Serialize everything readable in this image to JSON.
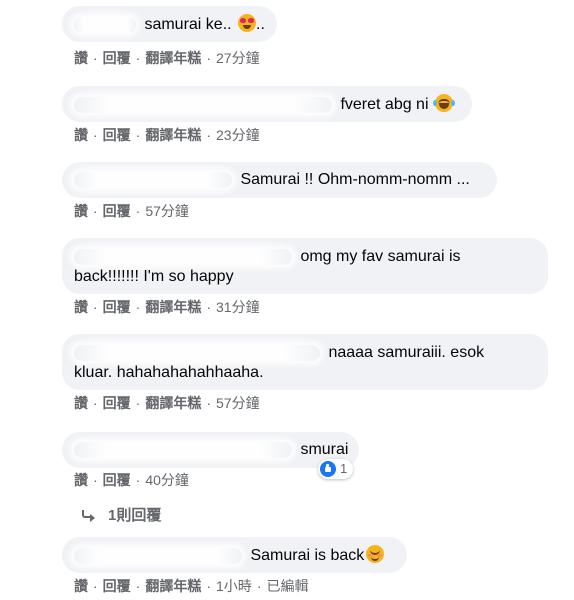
{
  "actions": {
    "like": "讚",
    "reply": "回覆",
    "translate": "翻譯年糕",
    "separator": "·",
    "edited": "已編輯"
  },
  "comments": [
    {
      "text": "samurai ke.. ",
      "suffix": "..",
      "emoji": "heart-eyes-emoji",
      "time": "27分鐘"
    },
    {
      "text": "fveret abg ni ",
      "emoji": "face-with-tears-of-joy-emoji",
      "time": "23分鐘"
    },
    {
      "text": "Samurai !! Ohm-nomm-nomm ...",
      "time": "57分鐘"
    },
    {
      "text_line1": "omg my fav samurai is",
      "text_line2": "back!!!!!!! I'm so happy",
      "time": "31分鐘"
    },
    {
      "text_line1": "naaaa samuraiii. esok",
      "text_line2": "kluar. hahahahahahhaaha.",
      "time": "57分鐘"
    },
    {
      "text": "smurai",
      "time": "40分鐘",
      "reaction_count": "1",
      "reaction_icon": "like-icon"
    },
    {
      "text": "Samurai is back",
      "emoji": "smiling-face-with-smiling-eyes-emoji",
      "time": "1小時"
    }
  ],
  "replies_link": {
    "label": "1則回覆",
    "icon": "reply-arrow-icon"
  },
  "colors": {
    "bubble": "#f0f2f5",
    "meta": "#65676b",
    "like_blue": "#1877f2"
  }
}
